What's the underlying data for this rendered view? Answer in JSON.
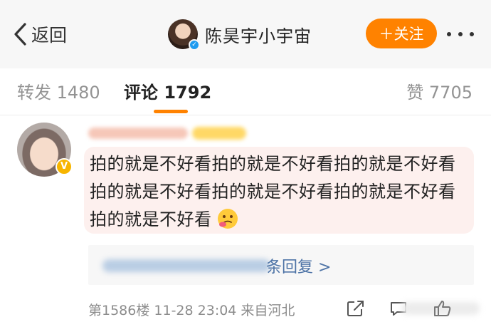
{
  "header": {
    "back_label": "返回",
    "account_name": "陈昊宇小宇宙",
    "follow_label": "＋关注",
    "more_icon": "more-dots-icon"
  },
  "tabs": {
    "repost": "转发 1480",
    "comments": "评论 1792",
    "likes": "赞 7705",
    "active": "comments"
  },
  "comment": {
    "text": "拍的就是不好看拍的就是不好看拍的就是不好看拍的就是不好看拍的就是不好看拍的就是不好看拍的就是不好看",
    "emoji": "thinking-face-emoji",
    "replies_link": "条回复 >",
    "meta": "第1586楼  11-28 23:04  来自河北"
  },
  "colors": {
    "accent": "#ff8200",
    "link": "#4d73a6",
    "bubble": "#fdf0ee",
    "verified_blue": "#1e9bf0",
    "verified_gold": "#f7b500"
  }
}
